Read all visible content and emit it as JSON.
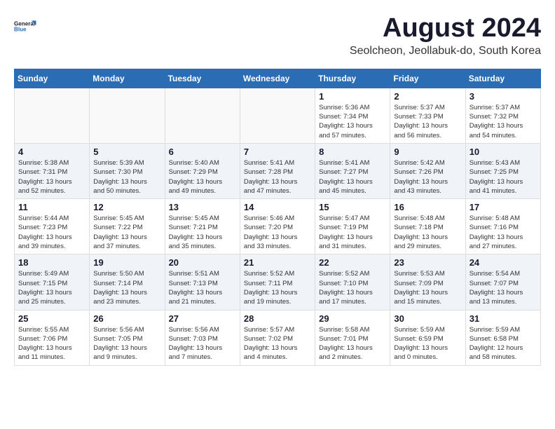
{
  "header": {
    "logo_line1": "General",
    "logo_line2": "Blue",
    "month_title": "August 2024",
    "location": "Seolcheon, Jeollabuk-do, South Korea"
  },
  "weekdays": [
    "Sunday",
    "Monday",
    "Tuesday",
    "Wednesday",
    "Thursday",
    "Friday",
    "Saturday"
  ],
  "weeks": [
    [
      {
        "day": "",
        "info": ""
      },
      {
        "day": "",
        "info": ""
      },
      {
        "day": "",
        "info": ""
      },
      {
        "day": "",
        "info": ""
      },
      {
        "day": "1",
        "info": "Sunrise: 5:36 AM\nSunset: 7:34 PM\nDaylight: 13 hours\nand 57 minutes."
      },
      {
        "day": "2",
        "info": "Sunrise: 5:37 AM\nSunset: 7:33 PM\nDaylight: 13 hours\nand 56 minutes."
      },
      {
        "day": "3",
        "info": "Sunrise: 5:37 AM\nSunset: 7:32 PM\nDaylight: 13 hours\nand 54 minutes."
      }
    ],
    [
      {
        "day": "4",
        "info": "Sunrise: 5:38 AM\nSunset: 7:31 PM\nDaylight: 13 hours\nand 52 minutes."
      },
      {
        "day": "5",
        "info": "Sunrise: 5:39 AM\nSunset: 7:30 PM\nDaylight: 13 hours\nand 50 minutes."
      },
      {
        "day": "6",
        "info": "Sunrise: 5:40 AM\nSunset: 7:29 PM\nDaylight: 13 hours\nand 49 minutes."
      },
      {
        "day": "7",
        "info": "Sunrise: 5:41 AM\nSunset: 7:28 PM\nDaylight: 13 hours\nand 47 minutes."
      },
      {
        "day": "8",
        "info": "Sunrise: 5:41 AM\nSunset: 7:27 PM\nDaylight: 13 hours\nand 45 minutes."
      },
      {
        "day": "9",
        "info": "Sunrise: 5:42 AM\nSunset: 7:26 PM\nDaylight: 13 hours\nand 43 minutes."
      },
      {
        "day": "10",
        "info": "Sunrise: 5:43 AM\nSunset: 7:25 PM\nDaylight: 13 hours\nand 41 minutes."
      }
    ],
    [
      {
        "day": "11",
        "info": "Sunrise: 5:44 AM\nSunset: 7:23 PM\nDaylight: 13 hours\nand 39 minutes."
      },
      {
        "day": "12",
        "info": "Sunrise: 5:45 AM\nSunset: 7:22 PM\nDaylight: 13 hours\nand 37 minutes."
      },
      {
        "day": "13",
        "info": "Sunrise: 5:45 AM\nSunset: 7:21 PM\nDaylight: 13 hours\nand 35 minutes."
      },
      {
        "day": "14",
        "info": "Sunrise: 5:46 AM\nSunset: 7:20 PM\nDaylight: 13 hours\nand 33 minutes."
      },
      {
        "day": "15",
        "info": "Sunrise: 5:47 AM\nSunset: 7:19 PM\nDaylight: 13 hours\nand 31 minutes."
      },
      {
        "day": "16",
        "info": "Sunrise: 5:48 AM\nSunset: 7:18 PM\nDaylight: 13 hours\nand 29 minutes."
      },
      {
        "day": "17",
        "info": "Sunrise: 5:48 AM\nSunset: 7:16 PM\nDaylight: 13 hours\nand 27 minutes."
      }
    ],
    [
      {
        "day": "18",
        "info": "Sunrise: 5:49 AM\nSunset: 7:15 PM\nDaylight: 13 hours\nand 25 minutes."
      },
      {
        "day": "19",
        "info": "Sunrise: 5:50 AM\nSunset: 7:14 PM\nDaylight: 13 hours\nand 23 minutes."
      },
      {
        "day": "20",
        "info": "Sunrise: 5:51 AM\nSunset: 7:13 PM\nDaylight: 13 hours\nand 21 minutes."
      },
      {
        "day": "21",
        "info": "Sunrise: 5:52 AM\nSunset: 7:11 PM\nDaylight: 13 hours\nand 19 minutes."
      },
      {
        "day": "22",
        "info": "Sunrise: 5:52 AM\nSunset: 7:10 PM\nDaylight: 13 hours\nand 17 minutes."
      },
      {
        "day": "23",
        "info": "Sunrise: 5:53 AM\nSunset: 7:09 PM\nDaylight: 13 hours\nand 15 minutes."
      },
      {
        "day": "24",
        "info": "Sunrise: 5:54 AM\nSunset: 7:07 PM\nDaylight: 13 hours\nand 13 minutes."
      }
    ],
    [
      {
        "day": "25",
        "info": "Sunrise: 5:55 AM\nSunset: 7:06 PM\nDaylight: 13 hours\nand 11 minutes."
      },
      {
        "day": "26",
        "info": "Sunrise: 5:56 AM\nSunset: 7:05 PM\nDaylight: 13 hours\nand 9 minutes."
      },
      {
        "day": "27",
        "info": "Sunrise: 5:56 AM\nSunset: 7:03 PM\nDaylight: 13 hours\nand 7 minutes."
      },
      {
        "day": "28",
        "info": "Sunrise: 5:57 AM\nSunset: 7:02 PM\nDaylight: 13 hours\nand 4 minutes."
      },
      {
        "day": "29",
        "info": "Sunrise: 5:58 AM\nSunset: 7:01 PM\nDaylight: 13 hours\nand 2 minutes."
      },
      {
        "day": "30",
        "info": "Sunrise: 5:59 AM\nSunset: 6:59 PM\nDaylight: 13 hours\nand 0 minutes."
      },
      {
        "day": "31",
        "info": "Sunrise: 5:59 AM\nSunset: 6:58 PM\nDaylight: 12 hours\nand 58 minutes."
      }
    ]
  ]
}
